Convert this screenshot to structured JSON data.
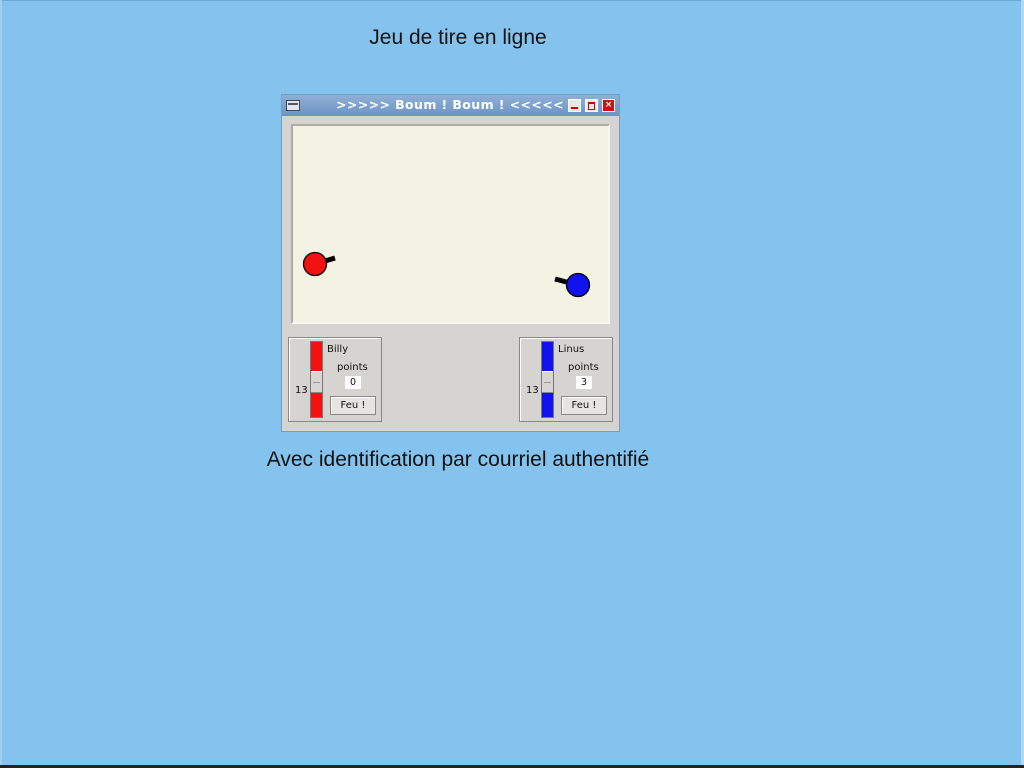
{
  "page": {
    "caption_top": "Jeu de tire en ligne",
    "caption_bottom": "Avec identification par courriel authentifié"
  },
  "window": {
    "title": ">>>>> Boum ! Boum ! <<<<<",
    "close_glyph": "×"
  },
  "game": {
    "players": [
      {
        "name": "Billy",
        "points_label": "points",
        "score": "0",
        "angle": "13",
        "fire_label": "Feu !",
        "color": "#f31212",
        "angle_fraction": 0.55
      },
      {
        "name": "Linus",
        "points_label": "points",
        "score": "3",
        "angle": "13",
        "fire_label": "Feu !",
        "color": "#1212ee",
        "angle_fraction": 0.55
      }
    ]
  }
}
